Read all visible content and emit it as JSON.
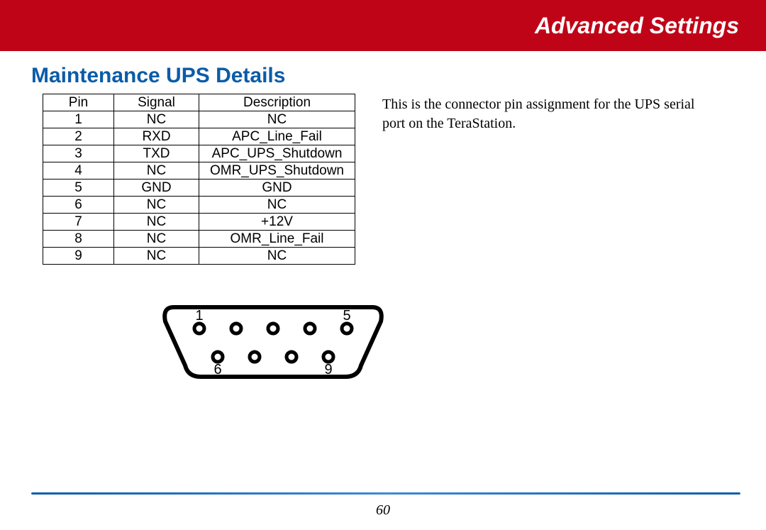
{
  "banner": "Advanced Settings",
  "section_title": "Maintenance UPS Details",
  "description": "This is the connector pin assignment for the UPS serial port on the TeraStation.",
  "table": {
    "headers": [
      "Pin",
      "Signal",
      "Description"
    ],
    "rows": [
      [
        "1",
        "NC",
        "NC"
      ],
      [
        "2",
        "RXD",
        "APC_Line_Fail"
      ],
      [
        "3",
        "TXD",
        "APC_UPS_Shutdown"
      ],
      [
        "4",
        "NC",
        "OMR_UPS_Shutdown"
      ],
      [
        "5",
        "GND",
        "GND"
      ],
      [
        "6",
        "NC",
        "NC"
      ],
      [
        "7",
        "NC",
        "+12V"
      ],
      [
        "8",
        "NC",
        "OMR_Line_Fail"
      ],
      [
        "9",
        "NC",
        "NC"
      ]
    ]
  },
  "connector": {
    "labels": {
      "tl": "1",
      "tr": "5",
      "bl": "6",
      "br": "9"
    }
  },
  "page_number": "60"
}
